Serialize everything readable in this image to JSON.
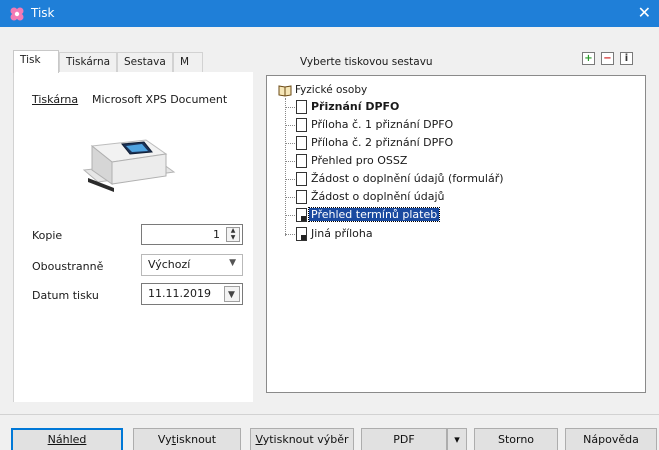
{
  "window": {
    "title": "Tisk",
    "close_glyph": "✕",
    "icon": "flower-app-icon"
  },
  "tabs": [
    {
      "label": "Tisk",
      "active": true
    },
    {
      "label": "Tiskárna",
      "active": false
    },
    {
      "label": "Sestava",
      "active": false
    },
    {
      "label": "M",
      "active": false
    }
  ],
  "printer": {
    "label": "Tiskárna",
    "value": "Microsoft XPS Document"
  },
  "fields": {
    "copies": {
      "label": "Kopie",
      "value": "1"
    },
    "duplex": {
      "label": "Oboustranně",
      "value": "Výchozí"
    },
    "date": {
      "label": "Datum tisku",
      "value": "11.11.2019"
    }
  },
  "report_panel": {
    "header": "Vyberte tiskovou sestavu",
    "icons": [
      "add-icon",
      "remove-icon",
      "info-icon"
    ],
    "icon_glyphs": [
      "+",
      "−",
      "i"
    ]
  },
  "tree": {
    "root": "Fyzické osoby",
    "items": [
      {
        "label": "Přiznání DPFO",
        "bold": true
      },
      {
        "label": "Příloha č. 1 přiznání DPFO"
      },
      {
        "label": "Příloha č. 2 přiznání DPFO"
      },
      {
        "label": "Přehled pro OSSZ"
      },
      {
        "label": "Žádost o doplnění údajů (formulář)"
      },
      {
        "label": "Žádost o doplnění údajů"
      },
      {
        "label": "Přehled termínů plateb",
        "selected": true,
        "locked": true
      },
      {
        "label": "Jiná příloha",
        "locked": true
      }
    ]
  },
  "buttons": {
    "preview": "Náhled",
    "print_prefix": "Vy",
    "print_accel": "t",
    "print_suffix": "isknout",
    "print_selection_accel": "V",
    "print_selection_rest": "ytisknout výběr",
    "pdf": "PDF",
    "pdf_dropdown": "▾",
    "cancel": "Storno",
    "help": "Nápověda"
  },
  "colors": {
    "titlebar": "#1f7fd8",
    "selection": "#1a4aa0"
  }
}
